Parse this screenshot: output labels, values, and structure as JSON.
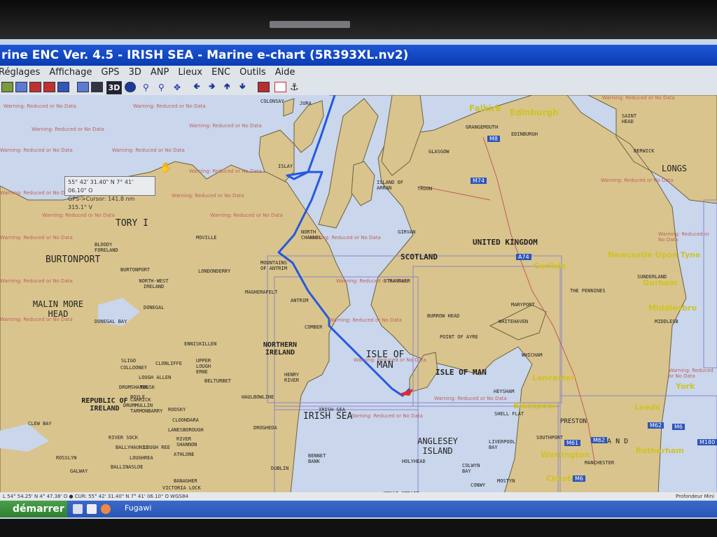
{
  "window": {
    "title": "rine ENC Ver. 4.5 - IRISH SEA - Marine e-chart  (5R393XL.nv2)"
  },
  "menu": {
    "items": [
      "Réglages",
      "Affichage",
      "GPS",
      "3D",
      "ANP",
      "Lieux",
      "ENC",
      "Outils",
      "Aide"
    ]
  },
  "toolbar": {
    "threed_label": "3D"
  },
  "cursor_box": {
    "line1": "55° 42' 31.40\" N  7° 41' 06.10\" O",
    "line2": "GPS->Cursor: 141.8 nm   315.1° V"
  },
  "warning_text": "Warning: Reduced or No Data",
  "labels": {
    "colonsay": "COLONSAY",
    "jura": "JURA",
    "islay": "ISLAY",
    "island_of_arran": "ISLAND OF ARRAN",
    "troon": "TROON",
    "glasgow": "GLASGOW",
    "grangemouth": "GRANGEMOUTH",
    "falkirk": "Falkirk",
    "edinburgh": "Edinburgh",
    "edinburgh_small": "EDINBURGH",
    "saint_head": "SAINT HEAD",
    "berwick": "BERWICK",
    "longs": "LONGS",
    "tory_i": "TORY I",
    "bloody_foreland": "BLOODY FORELAND",
    "burtonport_big": "BURTONPORT",
    "burtonport": "BURTONPORT",
    "north_west_ireland": "NORTH-WEST IRELAND",
    "malin_more_head": "MALIN MORE HEAD",
    "moville": "MOVILLE",
    "londonderry": "LONDONDERRY",
    "mountains_of_antrim": "MOUNTAINS OF ANTRIM",
    "magherafelt": "MAGHERAFELT",
    "antrim": "ANTRIM",
    "north_channel": "NORTH CHANNEL",
    "girvan": "GIRVAN",
    "scotland": "SCOTLAND",
    "stranraer": "STRANRAER",
    "united_kingdom": "UNITED KINGDOM",
    "carlisle": "Carlisle",
    "the_pennines": "THE PENNINES",
    "newcastle": "Newcastle Upon Tyne",
    "sunderland": "SUNDERLAND",
    "durham": "Durham",
    "middlesbrough": "Middlesbro",
    "middlesb_small": "MIDDLESB",
    "maryport": "MARYPORT",
    "whitehaven": "WHITEHAVEN",
    "burrow_head": "BURROW HEAD",
    "point_of_ayre": "POINT OF AYRE",
    "comber": "COMBER",
    "northern_ireland": "NORTHERN IRELAND",
    "isle_of_man_sea": "ISLE OF MAN",
    "isle_of_man": "ISLE OF MAN",
    "donegal": "DONEGAL",
    "donegal_bay": "DONEGAL BAY",
    "enniskillen": "ENNISKILLEN",
    "upper_lough_erne": "UPPER LOUGH ERNE",
    "sligo": "SLIGO",
    "collooney": "COLLOONEY",
    "clonliffe": "CLONLIFFE",
    "lough_allen": "LOUGH ALLEN",
    "belturbet": "BELTURBET",
    "drumshanbo": "DRUMSHANBO",
    "boyle": "BOYLE",
    "republic_of_ireland": "REPUBLIC OF IRELAND",
    "henry_river": "HENRY RIVER",
    "haulbowline": "HAULBOWLINE",
    "drogheda": "DROGHEDA",
    "irish_sea_small": "IRISH SEA",
    "irish_sea": "IRISH SEA",
    "anglesey_island": "ANGLESEY ISLAND",
    "liverpool_bay": "LIVERPOOL BAY",
    "shell_flat": "SHELL FLAT",
    "heysham": "HEYSHAM",
    "whicham": "WHICHAM",
    "lancaster": "Lancaster",
    "blackpool": "Blackpool",
    "preston": "PRESTON",
    "southport": "SOUTHPORT",
    "warrington": "Warrington",
    "manchester": "MANCHESTER",
    "chester": "Chester",
    "york": "York",
    "leeds": "Leeds",
    "rotherham": "Rotherham",
    "n_a_n_d": "N A N D",
    "clew_bay": "CLEW BAY",
    "river_suck": "RIVER SOCK",
    "ballyhaunis": "BALLYHAUNIS",
    "galway": "GALWAY",
    "athlone": "ATHLONE",
    "banagher": "BANAGHER",
    "victoria_lock": "VICTORIA LOCK",
    "ballinasloe": "BALLINASLOE",
    "roosky": "ROOSKY",
    "cloondara": "CLOONDARA",
    "lanesborough": "LANESBOROUGH",
    "river_shannon": "RIVER SHANNON",
    "dublin": "DUBLIN",
    "bennet_bank": "BENNET BANK",
    "menai_strait": "MENAI STRAIT",
    "colwyn_bay": "COLWYN BAY",
    "conwy": "CONWY",
    "mostyn": "MOSTYN",
    "tulsk": "TULSK",
    "drummullin": "DRUMMULLIN",
    "tarmonbarry": "TARMONBARRY",
    "carrick": "CARRICK",
    "lough_ree": "LOUGH REE",
    "rosslyn": "ROSSLYN",
    "loughrea": "LOUGHREA",
    "holyhead": "HOLYHEAD"
  },
  "roads": {
    "m8": "M8",
    "m74": "M74",
    "a74": "A74",
    "m6": "M6",
    "m62": "M62",
    "m61": "M61",
    "m62b": "M62",
    "m180": "M180",
    "m6b": "M6"
  },
  "status": {
    "left": "L 54° 54.25' N 4° 47.38' O  ●  CUR: 55° 42' 31.40\" N 7° 41' 06.10\" O  WGS84",
    "right": "Profondeur Mini"
  },
  "taskbar": {
    "start": "démarrer",
    "app": "Fugawi"
  },
  "colors": {
    "land": "#d9c48d",
    "sea": "#c9d6ec",
    "route": "#2459e0",
    "warning": "#c0605f"
  }
}
